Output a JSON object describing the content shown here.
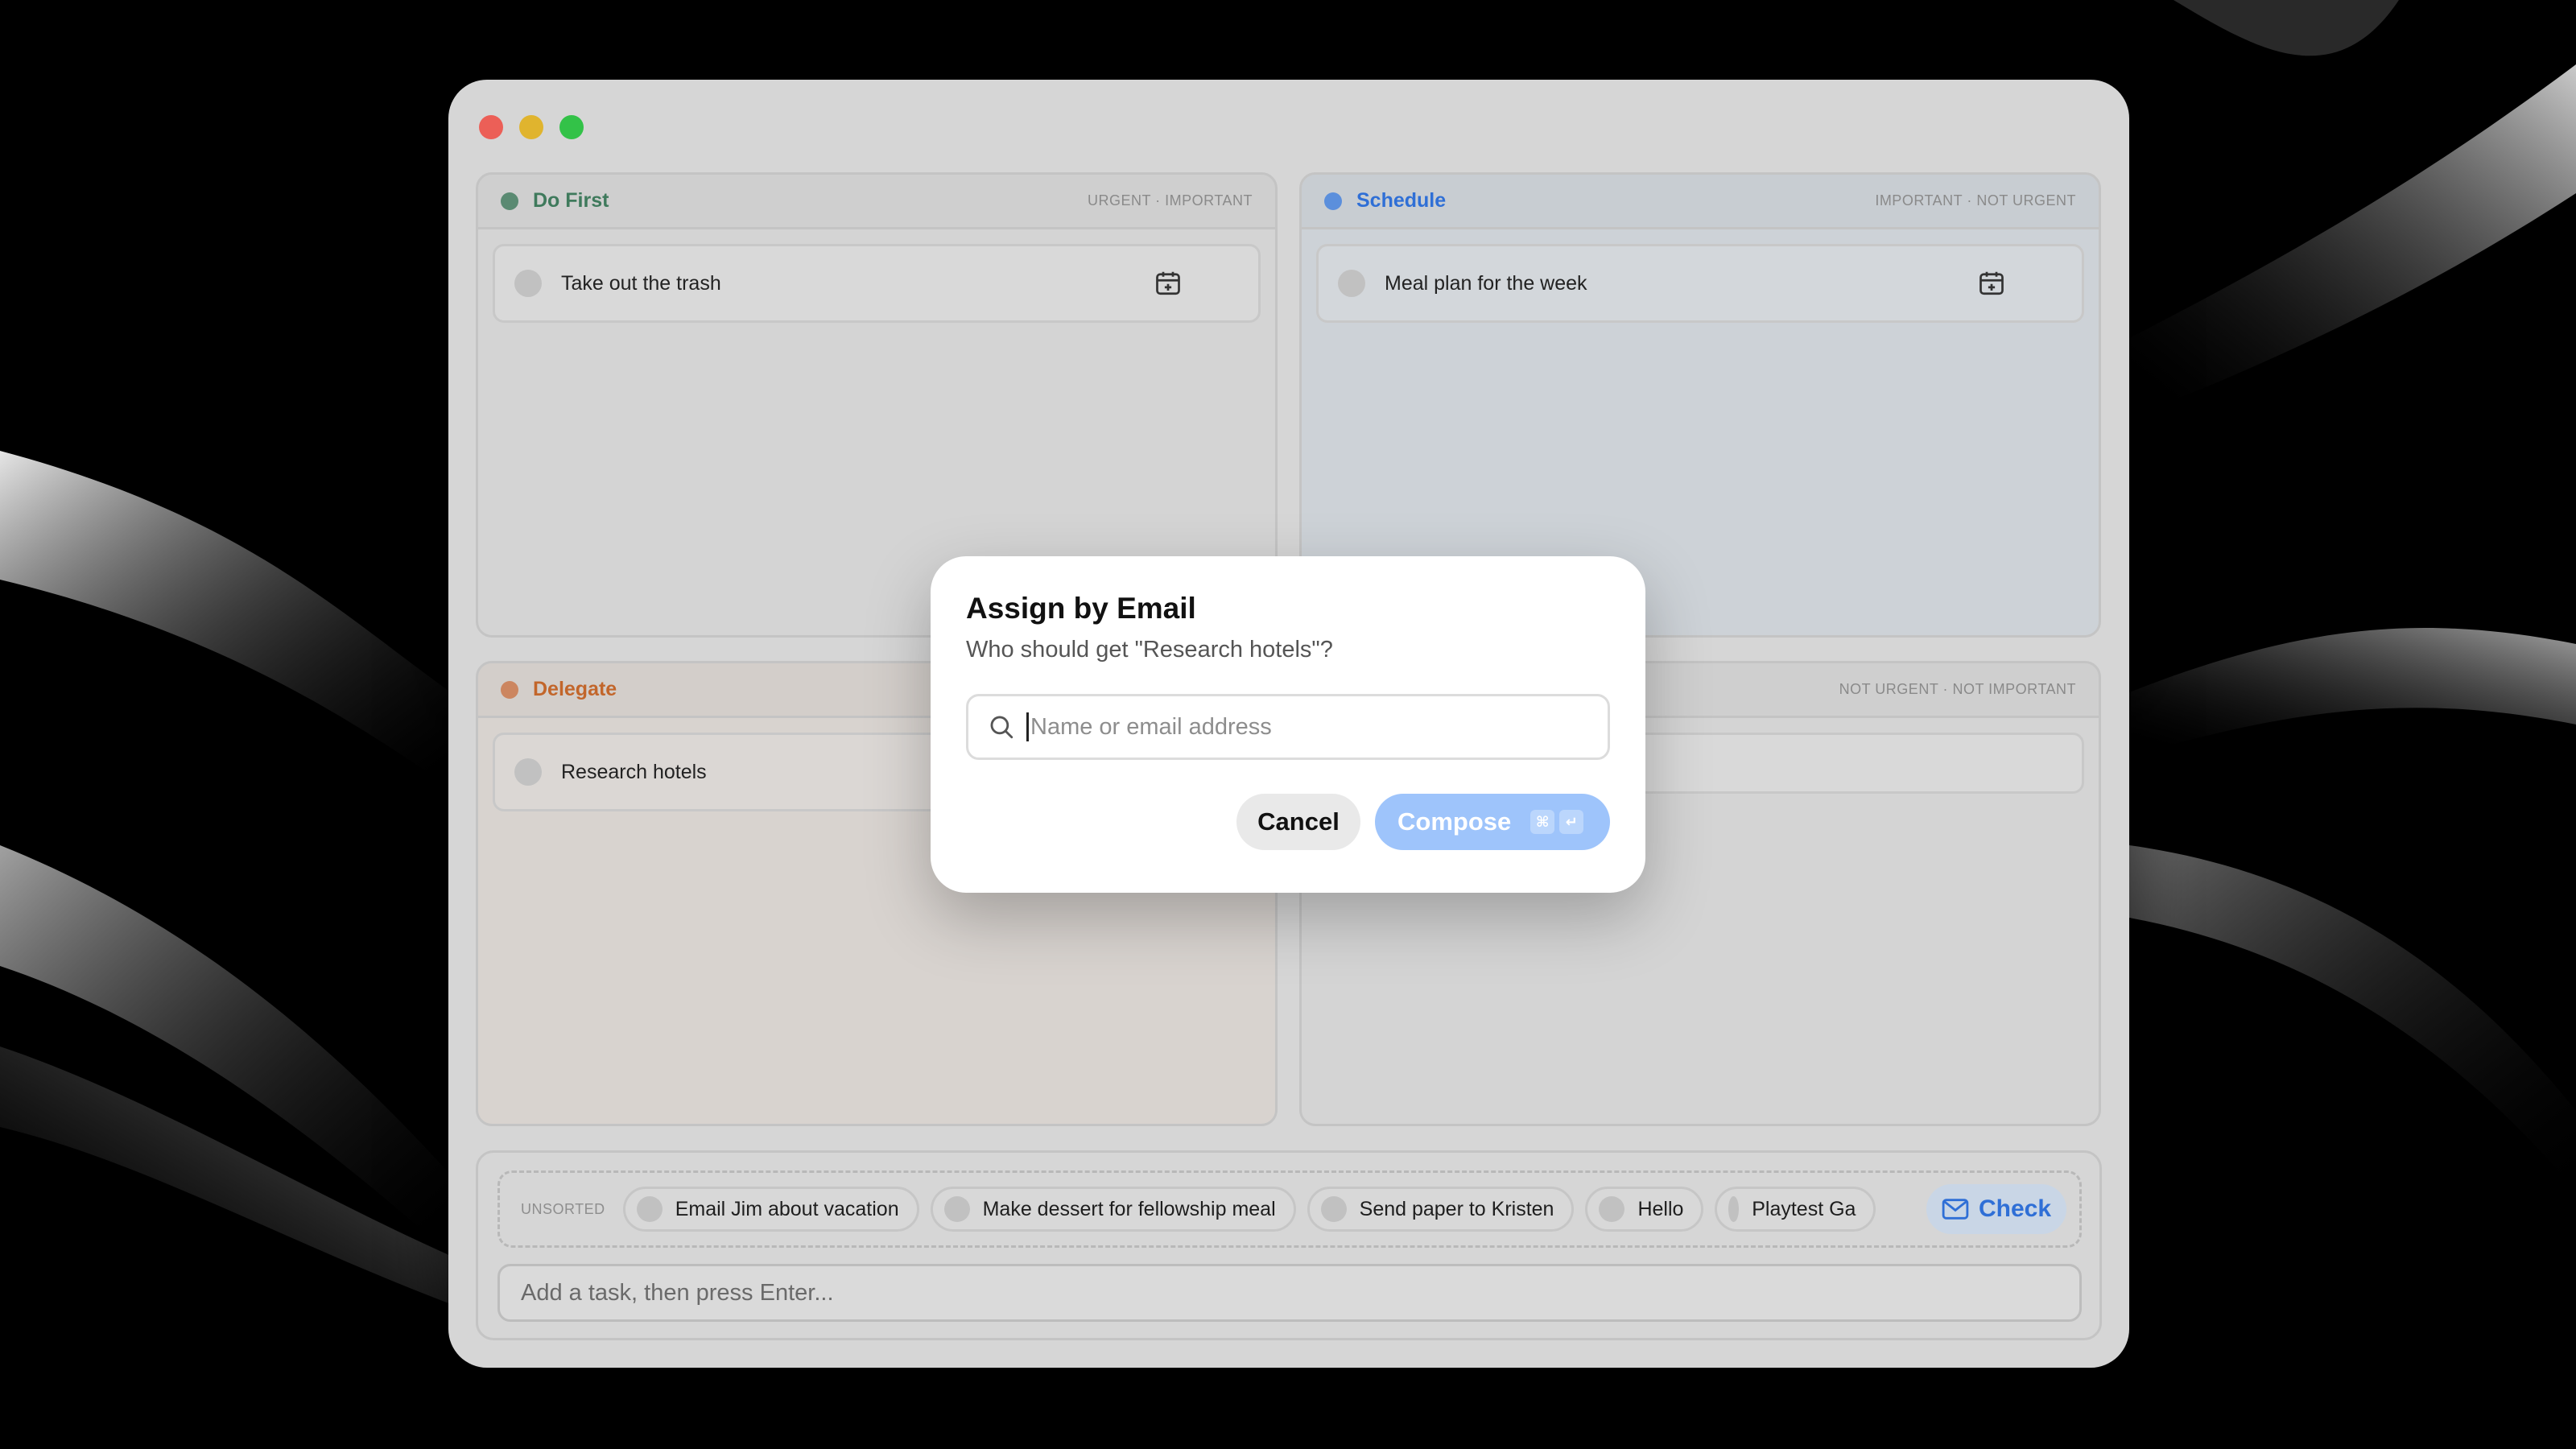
{
  "quadrants": {
    "do_first": {
      "title": "Do First",
      "tag": "URGENT · IMPORTANT",
      "color": "#3f7a5c",
      "dot": "#5a8a72",
      "tasks": [
        "Take out the trash"
      ]
    },
    "schedule": {
      "title": "Schedule",
      "tag": "IMPORTANT · NOT URGENT",
      "color": "#2f6fd6",
      "dot": "#5b8fdc",
      "tasks": [
        "Meal plan for the week"
      ]
    },
    "delegate": {
      "title": "Delegate",
      "tag": "",
      "color": "#c2662b",
      "dot": "#cc8660",
      "tasks": [
        "Research hotels"
      ]
    },
    "eliminate": {
      "title": "",
      "tag": "NOT URGENT · NOT IMPORTANT"
    }
  },
  "unsorted": {
    "label": "UNSORTED",
    "chips": [
      "Email Jim about vacation",
      "Make dessert for fellowship meal",
      "Send paper to Kristen",
      "Hello",
      "Playtest Ga"
    ],
    "check_label": "Check"
  },
  "add_task": {
    "placeholder": "Add a task, then press Enter..."
  },
  "dialog": {
    "title": "Assign by Email",
    "subtitle": "Who should get \"Research hotels\"?",
    "placeholder": "Name or email address",
    "cancel_label": "Cancel",
    "compose_label": "Compose",
    "shortcut_cmd": "⌘",
    "shortcut_enter": "↵"
  },
  "icons": {
    "calendar": "calendar-add-icon",
    "search": "search-icon",
    "mail": "mail-icon"
  }
}
